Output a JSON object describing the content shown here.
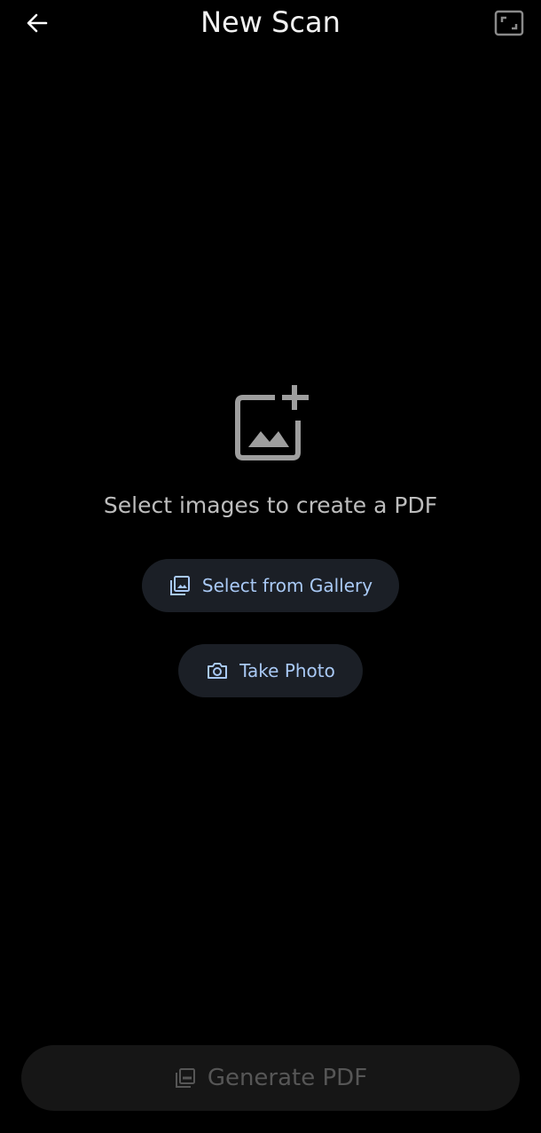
{
  "header": {
    "title": "New Scan",
    "back_icon": "arrow-left-icon",
    "fullscreen_icon": "crop-frame-icon"
  },
  "empty_state": {
    "icon": "add-photo-icon",
    "message": "Select images to create a PDF"
  },
  "actions": {
    "gallery": {
      "label": "Select from Gallery",
      "icon": "gallery-icon"
    },
    "photo": {
      "label": "Take Photo",
      "icon": "camera-icon"
    }
  },
  "footer": {
    "generate_label": "Generate PDF",
    "generate_icon": "pdf-icon",
    "enabled": false
  },
  "colors": {
    "background": "#000000",
    "button_bg": "#1b1f26",
    "accent_text": "#a9c9f5",
    "disabled_bg": "#161616",
    "disabled_text": "#565656"
  }
}
